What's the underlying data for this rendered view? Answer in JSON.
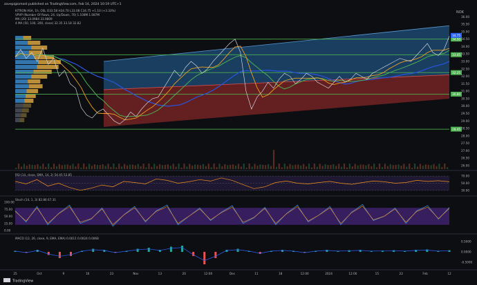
{
  "header": {
    "publisher": "zavepigiomost published on TradingView.com, Feb 14, 2024 10:19 UTC+1",
    "currency": "NOK"
  },
  "legend": {
    "symbol_line": "KITRON ASA, 1h, OSL  O33.58 H34.70 L33.08 C34.75 +1.10 (+3.33%)",
    "vpvr_line": "VPVP  (Number Of Rows, 24, Up/Down, 70)  1.108M  1.087M",
    "ma_line": "MA (20)  33.0984  33.9809",
    "mas_line": "4 MA (50, 100, 200, close)  32.35  33.18  32.82"
  },
  "price_labels": [
    {
      "value": "34.50",
      "color": "#4caf50"
    },
    {
      "value": "34.75",
      "color": "#2962ff"
    },
    {
      "value": "33.45",
      "color": "#4caf50"
    },
    {
      "value": "32.25",
      "color": "#4caf50"
    },
    {
      "value": "30.80",
      "color": "#4caf50"
    },
    {
      "value": "28.45",
      "color": "#4caf50"
    }
  ],
  "price_scale": [
    "36.00",
    "35.50",
    "35.00",
    "34.50",
    "34.00",
    "33.50",
    "33.00",
    "32.50",
    "32.00",
    "31.50",
    "31.00",
    "30.50",
    "30.00",
    "29.50",
    "29.00",
    "28.50",
    "28.00",
    "27.50",
    "27.00",
    "26.50",
    "26.00"
  ],
  "time_axis": [
    "25",
    "Oct",
    "9",
    "16",
    "23",
    "Nov",
    "13",
    "20",
    "12:00",
    "Dec",
    "11",
    "18",
    "12:00",
    "2024",
    "12:00",
    "15",
    "22",
    "Feb",
    "12"
  ],
  "rsi": {
    "label": "RSI (14, close, SMA, 14, 2)  54.45  53.85",
    "scale": [
      "70.00",
      "50.00",
      "30.00"
    ]
  },
  "stoch": {
    "label": "Stoch (14, 1, 3)  82.86  67.31",
    "scale": [
      "100.00",
      "75.00",
      "50.00",
      "25.00",
      "0.00"
    ]
  },
  "macd": {
    "label": "MACD (12, 26, close, 9, EMA, EMA)  0.0011  0.0024  0.0068",
    "scale": [
      "0.5000",
      "0.0000",
      "-0.5000"
    ]
  },
  "footer": "TradingView",
  "colors": {
    "background": "#0d0e11",
    "price_line": "#d1d4dc",
    "ma20": "#f0a020",
    "ma50": "#4caf50",
    "ma100": "#c0c000",
    "ma200": "#2952d8",
    "channel_upper": "#2a6aa8",
    "channel_lower": "#c83c3c",
    "support_line": "#4caf50",
    "rsi_line": "#f7931a",
    "stoch_band": "#5b2ca0"
  },
  "chart_data": {
    "type": "line",
    "price_range": [
      26.0,
      36.2
    ],
    "key_levels": [
      34.5,
      33.45,
      32.25,
      30.8,
      28.45
    ],
    "close": [
      33.3,
      33.8,
      33.2,
      33.6,
      33.0,
      33.9,
      32.8,
      33.2,
      32.0,
      32.4,
      31.5,
      31.2,
      29.9,
      29.4,
      29.2,
      29.6,
      29.8,
      29.4,
      29.0,
      28.8,
      29.1,
      29.6,
      29.3,
      29.8,
      30.2,
      30.5,
      30.6,
      31.2,
      31.8,
      32.4,
      32.0,
      32.6,
      33.0,
      32.7,
      32.2,
      32.5,
      33.0,
      33.4,
      33.8,
      34.2,
      34.5,
      33.6,
      31.0,
      29.8,
      30.6,
      31.0,
      31.6,
      31.2,
      31.8,
      32.2,
      32.0,
      31.5,
      31.8,
      32.2,
      32.0,
      31.6,
      31.4,
      31.2,
      31.6,
      32.0,
      31.6,
      31.8,
      32.2,
      32.0,
      31.8,
      32.2,
      32.4,
      32.6,
      32.8,
      33.0,
      33.2,
      33.1,
      33.0,
      33.4,
      33.8,
      34.2,
      33.6,
      33.4,
      33.8,
      34.7
    ],
    "rsi": [
      55,
      48,
      60,
      42,
      50,
      38,
      30,
      36,
      45,
      40,
      55,
      52,
      48,
      62,
      58,
      50,
      54,
      60,
      56,
      65,
      58,
      46,
      35,
      40,
      52,
      56,
      50,
      48,
      52,
      55,
      50,
      47,
      52,
      56,
      54,
      50,
      52,
      58,
      55,
      57,
      54
    ],
    "stoch": [
      70,
      30,
      85,
      20,
      60,
      90,
      25,
      40,
      80,
      15,
      55,
      85,
      30,
      70,
      90,
      20,
      50,
      80,
      35,
      65,
      88,
      25,
      45,
      82,
      20,
      60,
      90,
      30,
      55,
      85,
      20,
      65,
      92,
      35,
      50,
      80,
      25,
      70,
      88,
      40,
      82
    ],
    "macd_hist": [
      0.05,
      -0.05,
      0.1,
      -0.15,
      -0.3,
      -0.2,
      0.05,
      0.15,
      0.1,
      -0.05,
      0.05,
      0.15,
      0.2,
      0.1,
      0.25,
      0.3,
      -0.2,
      -0.6,
      -0.3,
      0.1,
      0.15,
      0.05,
      -0.1,
      0.05,
      0.1,
      0.05,
      -0.05,
      0.05,
      0.1,
      0.05,
      0.08,
      0.1,
      0.05,
      0.06,
      0.08,
      0.05,
      0.1,
      0.12,
      0.05,
      0.08
    ]
  }
}
